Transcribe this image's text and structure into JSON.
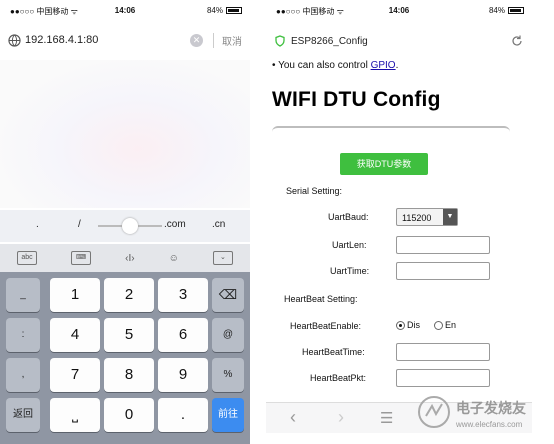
{
  "left": {
    "status": {
      "carrier": "●●○○○ 中国移动 ᯤ",
      "time": "14:06",
      "battery": "84%"
    },
    "address_bar": {
      "url": "192.168.4.1:80",
      "cancel": "取消"
    },
    "shortcut_row": {
      "dot": ".",
      "slash": "/",
      "com": ".com",
      "cn": ".cn"
    },
    "toolbar_icons": [
      "abc-keyboard-icon",
      "keyboard-icon",
      "cursor-icon",
      "emoji-icon",
      "collapse-icon"
    ],
    "keypad": {
      "side_left": [
        "_",
        ":",
        ",",
        "返回"
      ],
      "digits": [
        "1",
        "2",
        "3",
        "4",
        "5",
        "6",
        "7",
        "8",
        "9",
        "0"
      ],
      "side_right": [
        "⌫",
        "@",
        "%",
        "前往"
      ],
      "space": "⎵",
      "dot": "."
    }
  },
  "right": {
    "status": {
      "carrier": "●●○○○ 中国移动 ᯤ",
      "time": "14:06",
      "battery": "84%"
    },
    "tab_title": "ESP8266_Config",
    "note_prefix": "• You can also control ",
    "note_link": "GPIO",
    "note_suffix": ".",
    "heading": "WIFI DTU Config",
    "get_params_button": "获取DTU参数",
    "serial_section": "Serial Setting:",
    "uart_baud_label": "UartBaud:",
    "uart_baud_value": "115200",
    "uart_len_label": "UartLen:",
    "uart_time_label": "UartTime:",
    "heartbeat_section": "HeartBeat Setting:",
    "heartbeat_enable_label": "HeartBeatEnable:",
    "radio_dis": "Dis",
    "radio_en": "En",
    "heartbeat_time_label": "HeartBeatTime:",
    "heartbeat_pkt_label": "HeartBeatPkt:",
    "watermark": {
      "text": "电子发烧友",
      "url": "www.elecfans.com"
    }
  },
  "colors": {
    "accent_green": "#3fbf3f",
    "enter_blue": "#3c8cf0",
    "link_blue": "#1a0dab"
  }
}
